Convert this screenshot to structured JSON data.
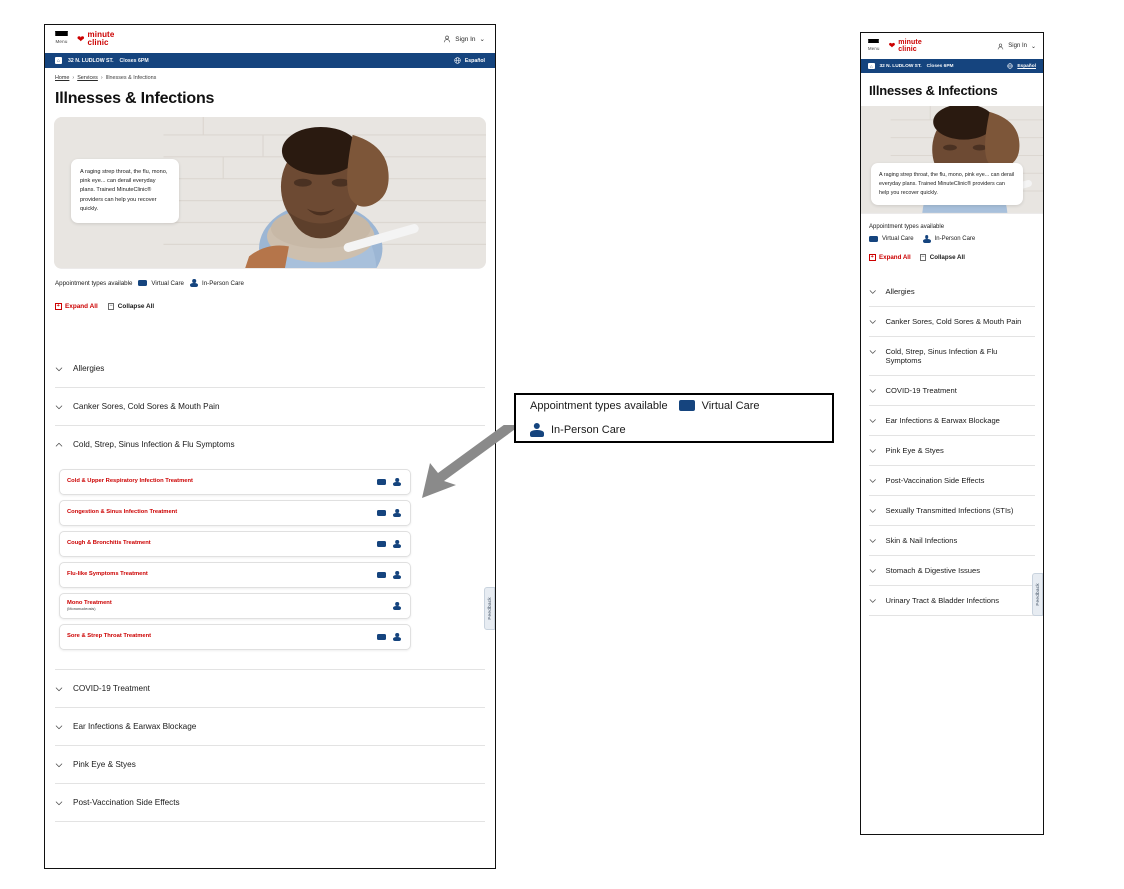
{
  "header": {
    "menu_label": "Menu",
    "logo_line1": "minute",
    "logo_line2": "clinic",
    "heart_icon": "heart-icon",
    "signin_label": "Sign In",
    "signin_chevron": "⌄",
    "person_icon": "person-outline-icon"
  },
  "store_bar": {
    "store_icon": "store-icon",
    "address": "32 N. LUDLOW ST.",
    "hours": "Closes 6PM",
    "globe_icon": "globe-icon",
    "language_label": "Español"
  },
  "breadcrumb": {
    "items": [
      "Home",
      "Services",
      "Illnesses & Infections"
    ],
    "separator": "›"
  },
  "page_title": "Illnesses & Infections",
  "hero": {
    "callout_text": "A raging strep throat, the flu, mono, pink eye... can derail everyday plans. Trained MinuteClinic® providers can help you recover quickly.",
    "image_alt": "man-with-fever-holding-thermometer-photo"
  },
  "legend": {
    "label": "Appointment types available",
    "virtual_icon": "video-camera-icon",
    "virtual_label": "Virtual Care",
    "inperson_icon": "person-icon",
    "inperson_label": "In-Person Care"
  },
  "controls": {
    "expand_symbol": "+",
    "expand_label": "Expand All",
    "collapse_symbol": "−",
    "collapse_label": "Collapse All"
  },
  "feedback_tab": "Feedback",
  "desktop_accordion": [
    {
      "label": "Allergies",
      "state": "collapsed",
      "chevron": "chevron-down-icon"
    },
    {
      "label": "Canker Sores, Cold Sores & Mouth Pain",
      "state": "collapsed",
      "chevron": "chevron-down-icon"
    },
    {
      "label": "Cold, Strep, Sinus Infection & Flu Symptoms",
      "state": "expanded",
      "chevron": "chevron-up-icon",
      "children": [
        {
          "title": "Cold & Upper Respiratory Infection Treatment",
          "subtitle": "",
          "virtual": true,
          "inperson": true
        },
        {
          "title": "Congestion & Sinus Infection Treatment",
          "subtitle": "",
          "virtual": true,
          "inperson": true
        },
        {
          "title": "Cough & Bronchitis Treatment",
          "subtitle": "",
          "virtual": true,
          "inperson": true
        },
        {
          "title": "Flu-like Symptoms Treatment",
          "subtitle": "",
          "virtual": true,
          "inperson": true
        },
        {
          "title": "Mono Treatment",
          "subtitle": "(Mononucleosis)",
          "virtual": false,
          "inperson": true
        },
        {
          "title": "Sore & Strep Throat Treatment",
          "subtitle": "",
          "virtual": true,
          "inperson": true
        }
      ]
    },
    {
      "label": "COVID-19 Treatment",
      "state": "collapsed",
      "chevron": "chevron-down-icon"
    },
    {
      "label": "Ear Infections & Earwax Blockage",
      "state": "collapsed",
      "chevron": "chevron-down-icon"
    },
    {
      "label": "Pink Eye & Styes",
      "state": "collapsed",
      "chevron": "chevron-down-icon"
    },
    {
      "label": "Post-Vaccination Side Effects",
      "state": "collapsed",
      "chevron": "chevron-down-icon"
    }
  ],
  "mobile_accordion": [
    {
      "label": "Allergies"
    },
    {
      "label": "Canker Sores, Cold Sores & Mouth Pain"
    },
    {
      "label": "Cold, Strep, Sinus Infection & Flu Symptoms"
    },
    {
      "label": "COVID-19 Treatment"
    },
    {
      "label": "Ear Infections & Earwax Blockage"
    },
    {
      "label": "Pink Eye & Styes"
    },
    {
      "label": "Post-Vaccination Side Effects"
    },
    {
      "label": "Sexually Transmitted Infections (STIs)"
    },
    {
      "label": "Skin & Nail Infections"
    },
    {
      "label": "Stomach & Digestive Issues"
    },
    {
      "label": "Urinary Tract & Bladder Infections"
    }
  ],
  "annotation": {
    "label": "Appointment types available",
    "virtual_label": "Virtual Care",
    "inperson_label": "In-Person Care",
    "arrow_icon": "arrow-pointing-down-left"
  },
  "colors": {
    "brand_red": "#cc0000",
    "brand_blue": "#15447e",
    "link_red": "#cc0000",
    "text_dark": "#1a1a1a"
  }
}
